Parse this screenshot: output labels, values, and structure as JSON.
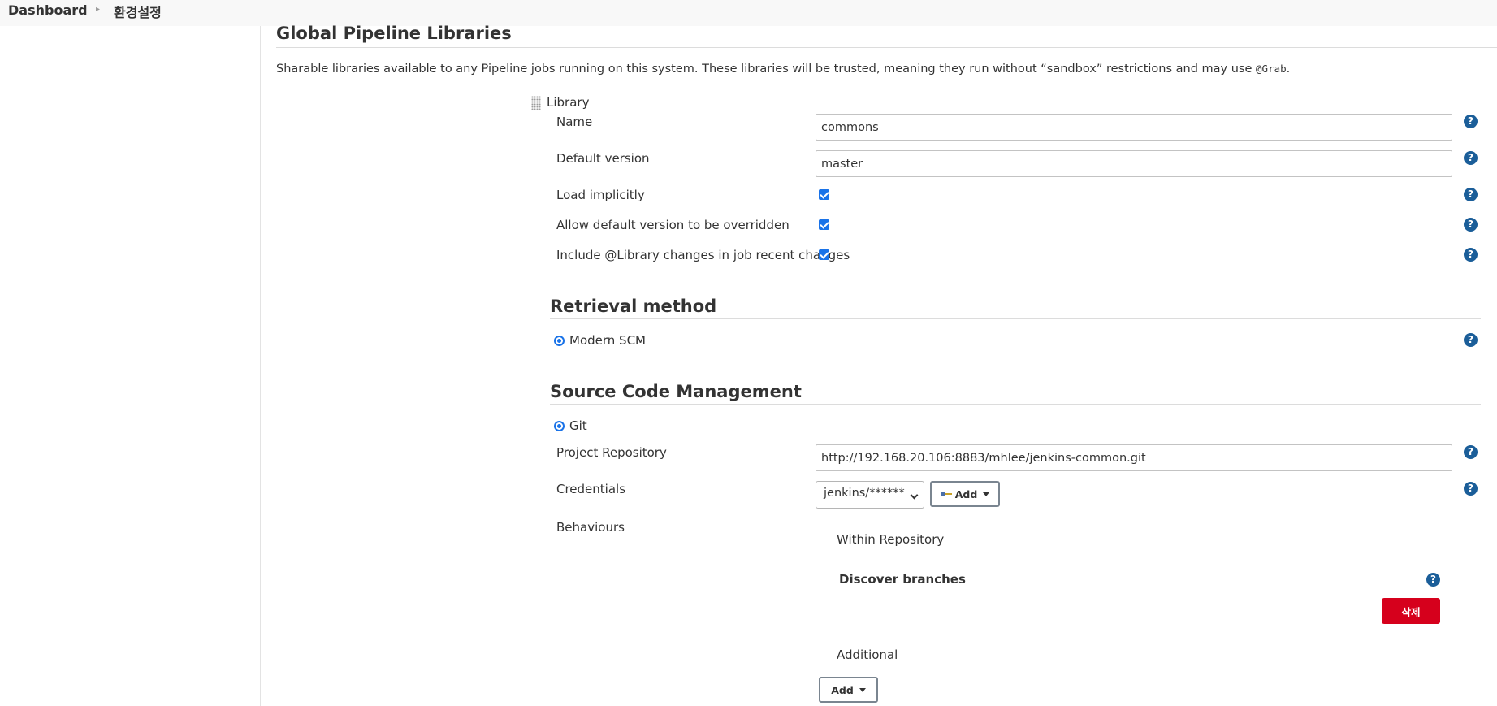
{
  "breadcrumb": {
    "home": "Dashboard",
    "current": "환경설정"
  },
  "libraries": {
    "title": "Global Pipeline Libraries",
    "description_prefix": "Sharable libraries available to any Pipeline jobs running on this system. These libraries will be trusted, meaning they run without “sandbox” restrictions and may use ",
    "description_code": "@Grab",
    "description_suffix": ".",
    "library_label": "Library",
    "name_label": "Name",
    "name_value": "commons",
    "default_version_label": "Default version",
    "default_version_value": "master",
    "load_implicitly_label": "Load implicitly",
    "load_implicitly_checked": true,
    "allow_override_label": "Allow default version to be overridden",
    "allow_override_checked": true,
    "include_changes_label": "Include @Library changes in job recent changes",
    "include_changes_checked": true
  },
  "retrieval": {
    "title": "Retrieval method",
    "option_label": "Modern SCM",
    "option_selected": true
  },
  "scm": {
    "title": "Source Code Management",
    "git_label": "Git",
    "git_selected": true,
    "project_repo_label": "Project Repository",
    "project_repo_value": "http://192.168.20.106:8883/mhlee/jenkins-common.git",
    "credentials_label": "Credentials",
    "credentials_value": "jenkins/******",
    "credentials_add_label": "Add",
    "behaviours_label": "Behaviours",
    "within_repo_label": "Within Repository",
    "discover_branches_label": "Discover branches",
    "delete_label": "삭제",
    "additional_label": "Additional",
    "add_label": "Add"
  },
  "help_glyph": "?",
  "colors": {
    "accent": "#1a73e8",
    "help": "#1b5e99",
    "danger": "#d6001c"
  }
}
